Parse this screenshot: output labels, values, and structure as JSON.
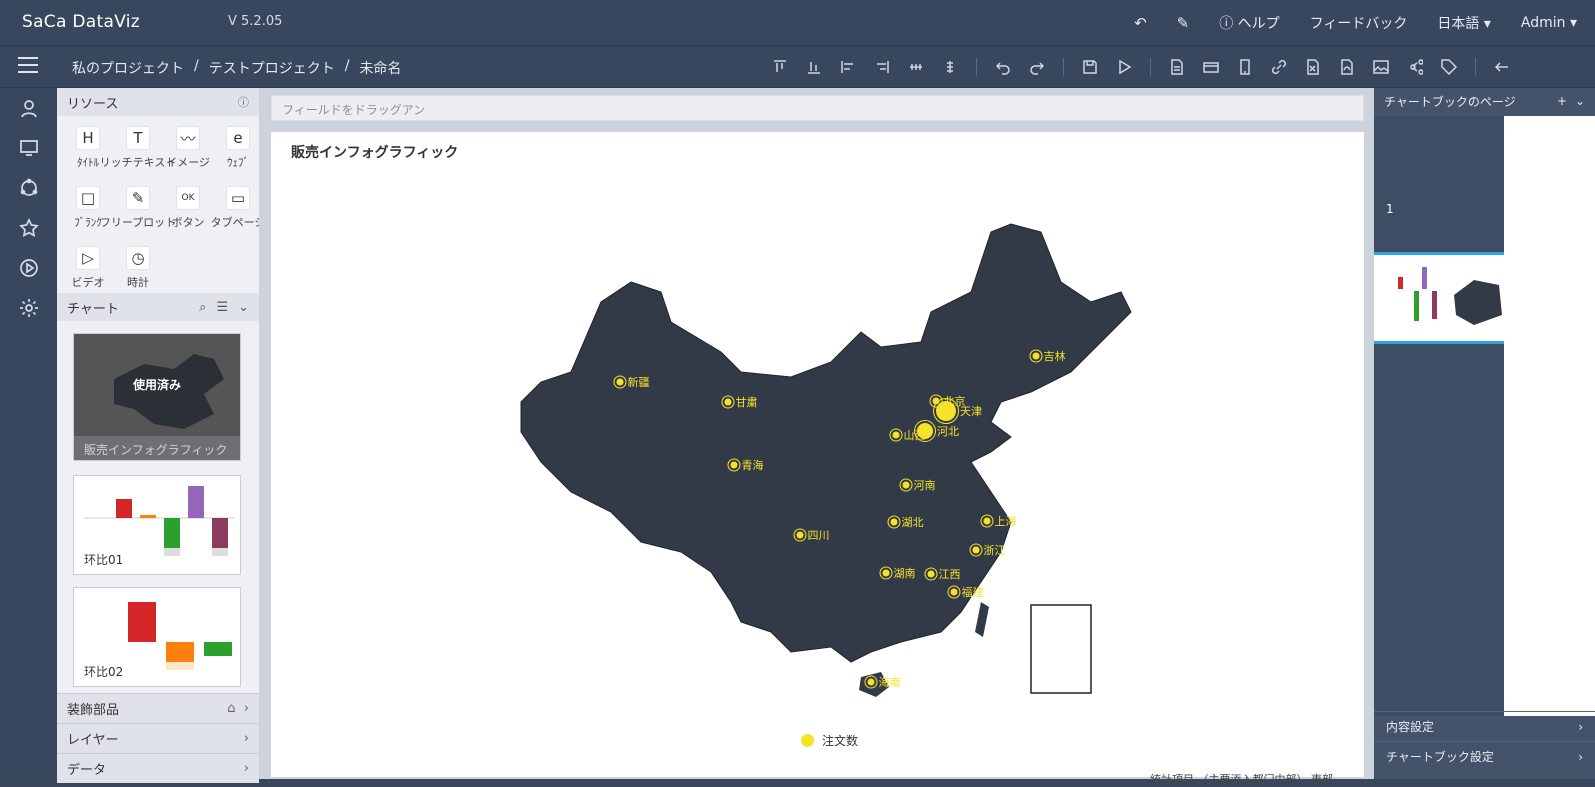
{
  "app": {
    "logo": "SaCa DataViz",
    "version": "V 5.2.05"
  },
  "topnav": {
    "help": "ヘルプ",
    "feedback": "フィードバック",
    "language": "日本語",
    "user": "Admin"
  },
  "breadcrumb": [
    "私のプロジェクト",
    "/",
    "テストプロジェクト",
    "/",
    "未命名"
  ],
  "resources": {
    "title": "リソース",
    "items": [
      {
        "icon": "H",
        "label": "ﾀｲﾄﾙ"
      },
      {
        "icon": "T",
        "label": "リッチテキスト"
      },
      {
        "icon": "〰",
        "label": "イメージ"
      },
      {
        "icon": "e",
        "label": "ｳｪﾌﾞ"
      },
      {
        "icon": "□",
        "label": "ﾌﾞﾗﾝｸ"
      },
      {
        "icon": "✎",
        "label": "フリープロット"
      },
      {
        "icon": "OK",
        "label": "ボタン"
      },
      {
        "icon": "▭",
        "label": "タブページ"
      },
      {
        "icon": "▷",
        "label": "ビデオ"
      },
      {
        "icon": "◷",
        "label": "時計"
      }
    ]
  },
  "charts": {
    "title": "チャート",
    "items": [
      {
        "caption": "販売インフォグラフィック",
        "badge": "使用済み"
      },
      {
        "caption": "环比01"
      },
      {
        "caption": "环比02"
      }
    ]
  },
  "accordions": {
    "decor": "装飾部品",
    "layer": "レイヤー",
    "data": "データ"
  },
  "canvas": {
    "drop_hint": "フィールドをドラッグアン",
    "chart_title": "販売インフォグラフィック",
    "legend": "注文数"
  },
  "map_points": [
    {
      "name": "新疆"
    },
    {
      "name": "甘粛"
    },
    {
      "name": "青海"
    },
    {
      "name": "四川"
    },
    {
      "name": "北京"
    },
    {
      "name": "天津"
    },
    {
      "name": "河北"
    },
    {
      "name": "山西"
    },
    {
      "name": "河南"
    },
    {
      "name": "湖北"
    },
    {
      "name": "上海"
    },
    {
      "name": "浙江"
    },
    {
      "name": "湖南"
    },
    {
      "name": "江西"
    },
    {
      "name": "福建"
    },
    {
      "name": "海南"
    },
    {
      "name": "吉林"
    }
  ],
  "footnote": "統計項目 （主要添入都门中部）  東部",
  "rightpane": {
    "title": "チャートブックのページ",
    "page": "1",
    "content_settings": "内容設定",
    "book_settings": "チャートブック設定"
  },
  "colors": {
    "accent": "#f5e32a",
    "map": "#333a47",
    "topbar": "#38475e"
  }
}
